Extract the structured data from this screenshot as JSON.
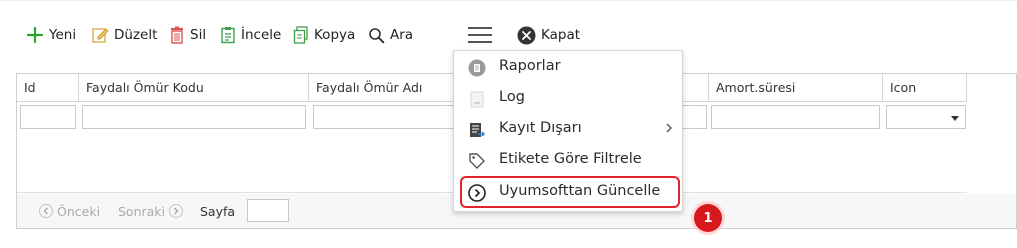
{
  "colors": {
    "accent_red": "#e0262b",
    "badge_red": "#d7191d",
    "green_add": "#2aa52a",
    "border": "#d0d0d0"
  },
  "toolbar": {
    "yeni": "Yeni",
    "duzelt": "Düzelt",
    "sil": "Sil",
    "incele": "İncele",
    "kopya": "Kopya",
    "ara": "Ara",
    "kapat": "Kapat"
  },
  "grid": {
    "columns": [
      "Id",
      "Faydalı Ömür Kodu",
      "Faydalı Ömür Adı",
      "Amort.süresi",
      "Icon"
    ]
  },
  "pager": {
    "onceki": "Önceki",
    "sonraki": "Sonraki",
    "sayfa": "Sayfa"
  },
  "menu": {
    "items": [
      {
        "label": "Raporlar",
        "icon": "report-icon"
      },
      {
        "label": "Log",
        "icon": "log-icon"
      },
      {
        "label": "Kayıt Dışarı",
        "icon": "export-icon",
        "has_submenu": true
      },
      {
        "label": "Etikete Göre Filtrele",
        "icon": "tag-icon"
      },
      {
        "label": "Uyumsofttan Güncelle",
        "icon": "circle-arrow-icon",
        "highlighted": true
      }
    ]
  },
  "badge": {
    "number": "1"
  }
}
